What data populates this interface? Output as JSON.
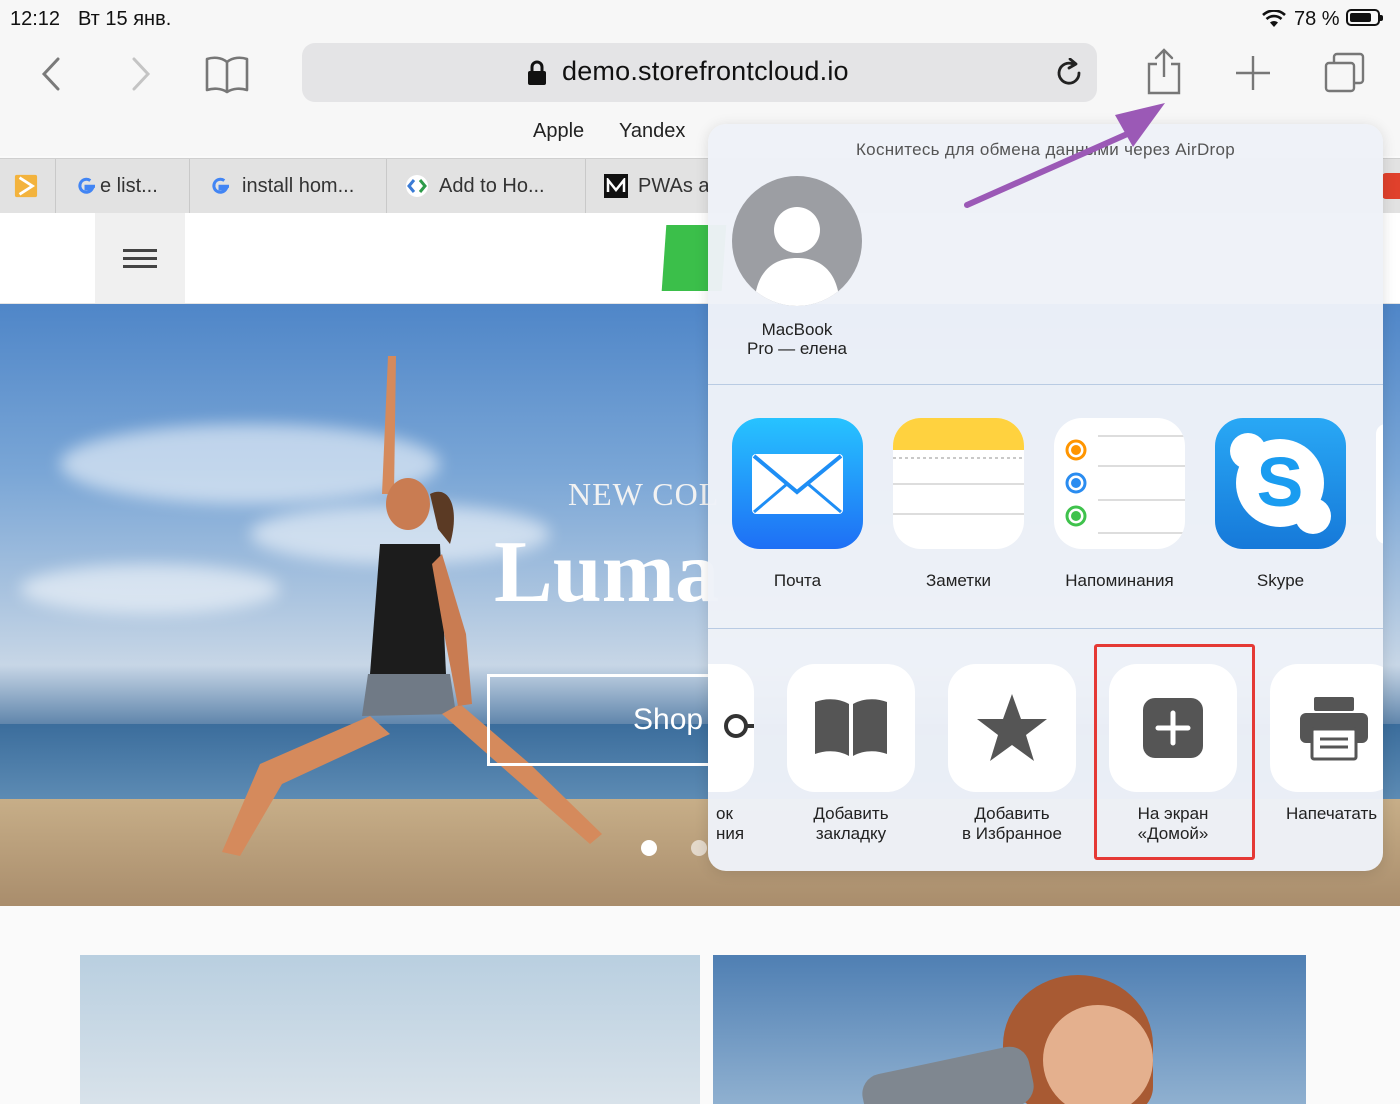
{
  "status_bar": {
    "time": "12:12",
    "date": "Вт 15 янв.",
    "battery": "78 %"
  },
  "toolbar": {
    "url": "demo.storefrontcloud.io",
    "favorites": [
      "Apple",
      "Yandex"
    ]
  },
  "tabs": [
    {
      "title": "e list..."
    },
    {
      "title": "install hom..."
    },
    {
      "title": "Add to Ho..."
    },
    {
      "title": "PWAs a"
    }
  ],
  "hero": {
    "eyebrow": "NEW COL",
    "title": "Luma",
    "button": "Shop"
  },
  "share_sheet": {
    "airdrop_hint": "Коснитесь для обмена данными через AirDrop",
    "contact": {
      "name_line1": "MacBook",
      "name_line2": "Pro — елена"
    },
    "apps": [
      {
        "label": "Почта",
        "icon": "mail-icon"
      },
      {
        "label": "Заметки",
        "icon": "notes-icon"
      },
      {
        "label": "Напоминания",
        "icon": "reminders-icon"
      },
      {
        "label": "Skype",
        "icon": "skype-icon"
      }
    ],
    "actions": [
      {
        "line1": "ок",
        "line2": "ния",
        "icon": "copy-icon"
      },
      {
        "line1": "Добавить",
        "line2": "закладку",
        "icon": "bookmark-icon"
      },
      {
        "line1": "Добавить",
        "line2": "в Избранное",
        "icon": "star-icon"
      },
      {
        "line1": "На экран",
        "line2": "«Домой»",
        "icon": "add-to-home-icon"
      },
      {
        "line1": "Напечатать",
        "line2": "",
        "icon": "print-icon"
      }
    ]
  },
  "colors": {
    "highlight": "#e53935",
    "arrow": "#9b59b6",
    "mail": "#1e8ef5",
    "skype": "#1a9cf0",
    "logo": "#3bbf4a"
  }
}
